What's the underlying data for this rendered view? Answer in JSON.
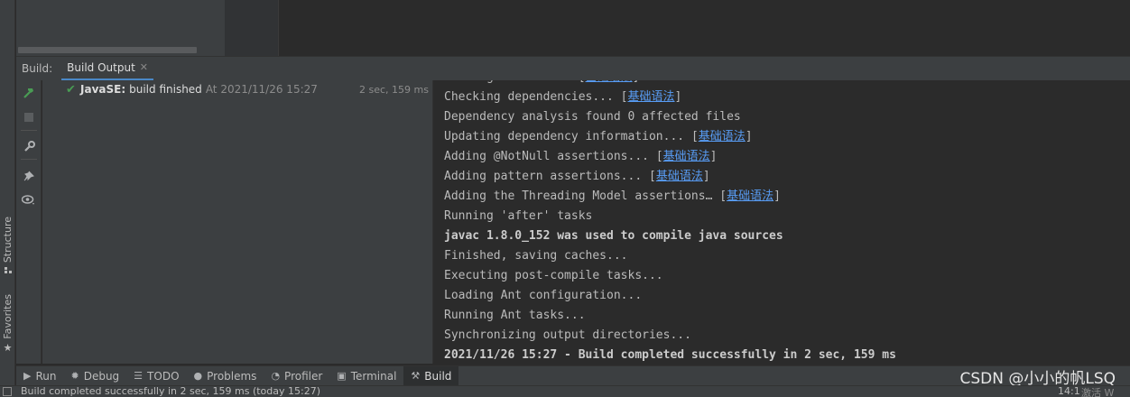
{
  "left_strip": {
    "structure_label": "Structure",
    "favorites_label": "Favorites"
  },
  "build_header": {
    "label": "Build:",
    "tab_label": "Build Output"
  },
  "tool_icons": [
    "hammer-icon",
    "stop-icon",
    "wrench-icon",
    "pin-icon",
    "eye-icon"
  ],
  "tree": {
    "title": "JavaSE:",
    "status": "build finished",
    "time": "At 2021/11/26 15:27",
    "duration": "2 sec, 159 ms"
  },
  "output": {
    "lines": [
      {
        "text": "Writing classes... ",
        "link": "基础语法",
        "bold": false
      },
      {
        "text": "Checking dependencies... ",
        "link": "基础语法",
        "bold": false
      },
      {
        "text": "Dependency analysis found 0 affected files",
        "link": "",
        "bold": false
      },
      {
        "text": "Updating dependency information... ",
        "link": "基础语法",
        "bold": false
      },
      {
        "text": "Adding @NotNull assertions... ",
        "link": "基础语法",
        "bold": false
      },
      {
        "text": "Adding pattern assertions... ",
        "link": "基础语法",
        "bold": false
      },
      {
        "text": "Adding the Threading Model assertions… ",
        "link": "基础语法",
        "bold": false
      },
      {
        "text": "Running 'after' tasks",
        "link": "",
        "bold": false
      },
      {
        "text": "javac 1.8.0_152 was used to compile java sources",
        "link": "",
        "bold": true
      },
      {
        "text": "Finished, saving caches...",
        "link": "",
        "bold": false
      },
      {
        "text": "Executing post-compile tasks...",
        "link": "",
        "bold": false
      },
      {
        "text": "Loading Ant configuration...",
        "link": "",
        "bold": false
      },
      {
        "text": "Running Ant tasks...",
        "link": "",
        "bold": false
      },
      {
        "text": "Synchronizing output directories...",
        "link": "",
        "bold": false
      },
      {
        "text": "2021/11/26 15:27 - Build completed successfully in 2 sec, 159 ms",
        "link": "",
        "bold": true
      }
    ]
  },
  "bottom_tabs": [
    {
      "label": "Run",
      "icon": "play-icon",
      "active": false
    },
    {
      "label": "Debug",
      "icon": "bug-icon",
      "active": false
    },
    {
      "label": "TODO",
      "icon": "list-icon",
      "active": false
    },
    {
      "label": "Problems",
      "icon": "info-icon",
      "active": false
    },
    {
      "label": "Profiler",
      "icon": "profiler-icon",
      "active": false
    },
    {
      "label": "Terminal",
      "icon": "terminal-icon",
      "active": false
    },
    {
      "label": "Build",
      "icon": "hammer-icon",
      "active": true
    }
  ],
  "watermark": "CSDN @小小的帆LSQ",
  "status_bar": {
    "message": "Build completed successfully in 2 sec, 159 ms (today 15:27)",
    "position": "14:1",
    "extra": "激活 W"
  },
  "colors": {
    "accent": "#4a88c7",
    "success": "#499c54",
    "link": "#589df6"
  }
}
